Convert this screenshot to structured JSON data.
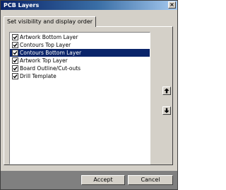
{
  "window": {
    "title": "PCB Layers",
    "close_glyph": "×"
  },
  "tab": {
    "label": "Set visibility and display order"
  },
  "layers": [
    {
      "label": "Artwork Bottom Layer",
      "checked": true,
      "selected": false
    },
    {
      "label": "Contours Top Layer",
      "checked": true,
      "selected": false
    },
    {
      "label": "Contours Bottom Layer",
      "checked": true,
      "selected": true
    },
    {
      "label": "Artwork Top Layer",
      "checked": true,
      "selected": false
    },
    {
      "label": "Board Outline/Cut-outs",
      "checked": true,
      "selected": false
    },
    {
      "label": "Drill Template",
      "checked": true,
      "selected": false
    }
  ],
  "move_buttons": {
    "up_icon": "arrow-up-icon",
    "down_icon": "arrow-down-icon"
  },
  "buttons": {
    "accept_label": "Accept",
    "cancel_label": "Cancel"
  },
  "colors": {
    "face": "#d4d0c8",
    "selection": "#0a246a",
    "titlebar_start": "#0a246a",
    "titlebar_end": "#a6caf0"
  }
}
